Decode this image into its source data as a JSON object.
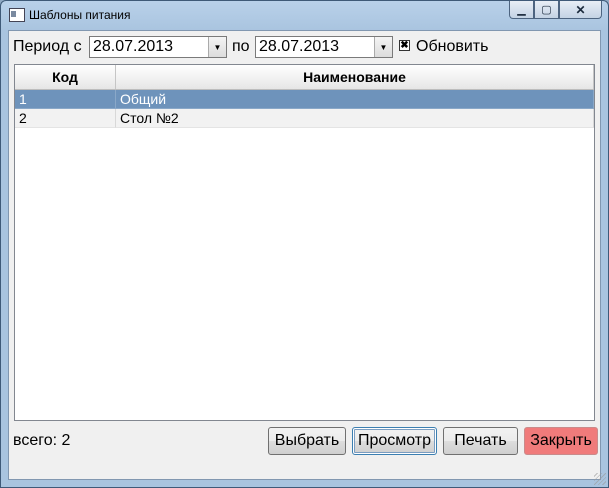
{
  "window": {
    "title": "Шаблоны питания"
  },
  "filter": {
    "period_from_label": "Период с",
    "date_from": "28.07.2013",
    "period_to_label": "по",
    "date_to": "28.07.2013",
    "refresh_label": "Обновить",
    "refresh_checked": true
  },
  "grid": {
    "columns": [
      "Код",
      "Наименование"
    ],
    "rows": [
      {
        "code": "1",
        "name": "Общий",
        "selected": true
      },
      {
        "code": "2",
        "name": "Стол №2",
        "selected": false
      }
    ]
  },
  "footer": {
    "total_text": "всего: 2",
    "select_label": "Выбрать",
    "view_label": "Просмотр",
    "print_label": "Печать",
    "close_label": "Закрыть"
  },
  "colors": {
    "selection": "#6e93bb",
    "close_button": "#f07b7b"
  }
}
